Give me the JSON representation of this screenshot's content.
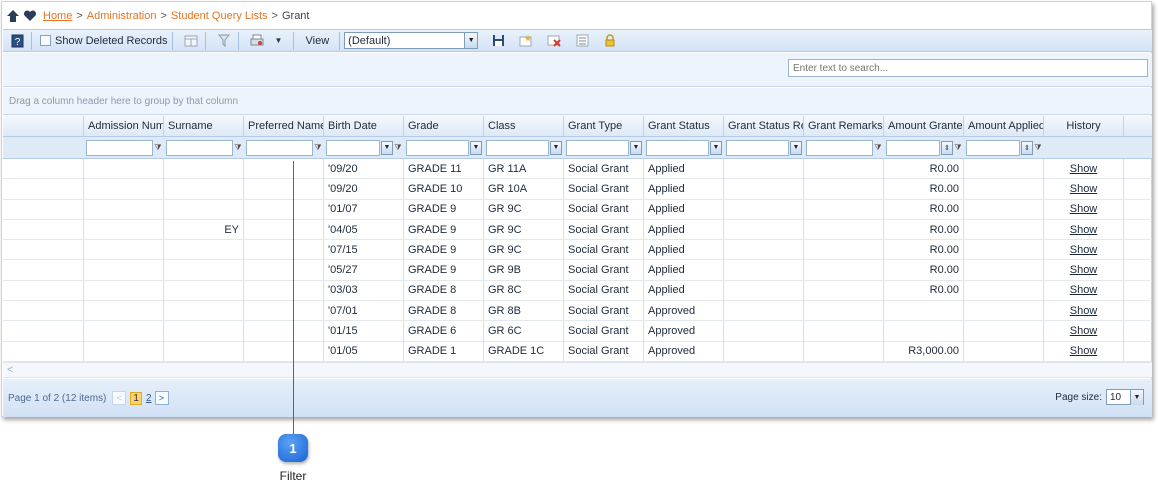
{
  "breadcrumb": {
    "items": [
      "Home",
      "Administration",
      "Student Query Lists"
    ],
    "current": "Grant",
    "separator": ">"
  },
  "toolbar": {
    "show_deleted_label": "Show Deleted Records",
    "view_label": "View",
    "view_value": "(Default)"
  },
  "search": {
    "placeholder": "Enter text to search..."
  },
  "group_hint": "Drag a column header here to group by that column",
  "columns": [
    "",
    "Admission Numb",
    "Surname",
    "Preferred Name",
    "Birth Date",
    "Grade",
    "Class",
    "Grant Type",
    "Grant Status",
    "Grant Status Rea",
    "Grant Remarks",
    "Amount Granted",
    "Amount Applied",
    "History"
  ],
  "rows": [
    {
      "birth": "'09/20",
      "grade": "GRADE 11",
      "class": "GR 11A",
      "type": "Social Grant",
      "status": "Applied",
      "granted": "R0.00",
      "history": "Show"
    },
    {
      "birth": "'09/20",
      "grade": "GRADE 10",
      "class": "GR 10A",
      "type": "Social Grant",
      "status": "Applied",
      "granted": "R0.00",
      "history": "Show"
    },
    {
      "birth": "'01/07",
      "grade": "GRADE 9",
      "class": "GR 9C",
      "type": "Social Grant",
      "status": "Applied",
      "granted": "R0.00",
      "history": "Show"
    },
    {
      "birth": "'04/05",
      "grade": "GRADE 9",
      "class": "GR 9C",
      "type": "Social Grant",
      "status": "Applied",
      "granted": "R0.00",
      "history": "Show",
      "surname_fragment": "EY"
    },
    {
      "birth": "'07/15",
      "grade": "GRADE 9",
      "class": "GR 9C",
      "type": "Social Grant",
      "status": "Applied",
      "granted": "R0.00",
      "history": "Show"
    },
    {
      "birth": "'05/27",
      "grade": "GRADE 9",
      "class": "GR 9B",
      "type": "Social Grant",
      "status": "Applied",
      "granted": "R0.00",
      "history": "Show"
    },
    {
      "birth": "'03/03",
      "grade": "GRADE 8",
      "class": "GR 8C",
      "type": "Social Grant",
      "status": "Applied",
      "granted": "R0.00",
      "history": "Show"
    },
    {
      "birth": "'07/01",
      "grade": "GRADE 8",
      "class": "GR 8B",
      "type": "Social Grant",
      "status": "Approved",
      "granted": "",
      "history": "Show"
    },
    {
      "birth": "'01/15",
      "grade": "GRADE 6",
      "class": "GR 6C",
      "type": "Social Grant",
      "status": "Approved",
      "granted": "",
      "history": "Show"
    },
    {
      "birth": "'01/05",
      "grade": "GRADE 1",
      "class": "GRADE 1C",
      "type": "Social Grant",
      "status": "Approved",
      "granted": "R3,000.00",
      "history": "Show"
    }
  ],
  "pager": {
    "summary": "Page 1 of 2 (12 items)",
    "pages": [
      "1",
      "2"
    ],
    "current_page": "1",
    "page_size_label": "Page size:",
    "page_size": "10"
  },
  "callout": {
    "number": "1",
    "label": "Filter"
  },
  "colors": {
    "link": "#e57321",
    "accent": "#1964d5",
    "header_bg": "#dde9f7"
  }
}
